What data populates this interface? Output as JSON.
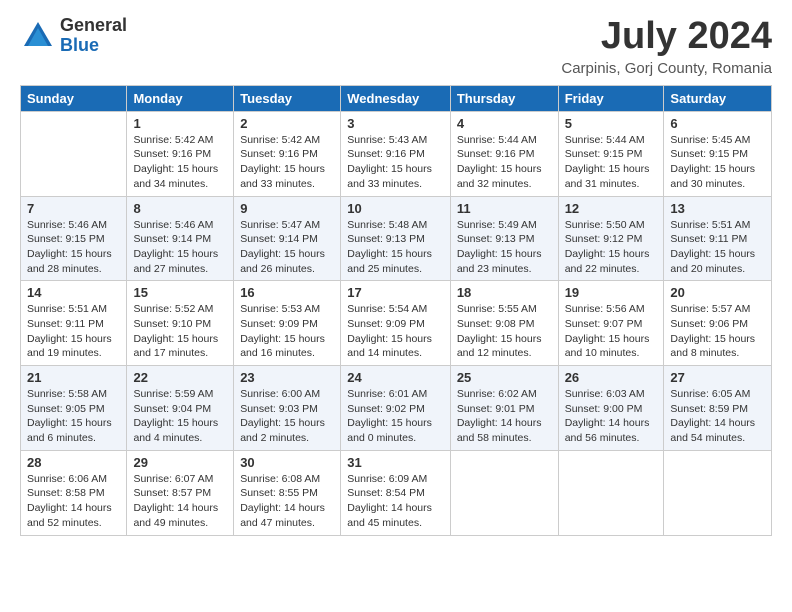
{
  "header": {
    "logo_general": "General",
    "logo_blue": "Blue",
    "title": "July 2024",
    "subtitle": "Carpinis, Gorj County, Romania"
  },
  "weekdays": [
    "Sunday",
    "Monday",
    "Tuesday",
    "Wednesday",
    "Thursday",
    "Friday",
    "Saturday"
  ],
  "weeks": [
    [
      {
        "day": "",
        "info": ""
      },
      {
        "day": "1",
        "info": "Sunrise: 5:42 AM\nSunset: 9:16 PM\nDaylight: 15 hours\nand 34 minutes."
      },
      {
        "day": "2",
        "info": "Sunrise: 5:42 AM\nSunset: 9:16 PM\nDaylight: 15 hours\nand 33 minutes."
      },
      {
        "day": "3",
        "info": "Sunrise: 5:43 AM\nSunset: 9:16 PM\nDaylight: 15 hours\nand 33 minutes."
      },
      {
        "day": "4",
        "info": "Sunrise: 5:44 AM\nSunset: 9:16 PM\nDaylight: 15 hours\nand 32 minutes."
      },
      {
        "day": "5",
        "info": "Sunrise: 5:44 AM\nSunset: 9:15 PM\nDaylight: 15 hours\nand 31 minutes."
      },
      {
        "day": "6",
        "info": "Sunrise: 5:45 AM\nSunset: 9:15 PM\nDaylight: 15 hours\nand 30 minutes."
      }
    ],
    [
      {
        "day": "7",
        "info": "Sunrise: 5:46 AM\nSunset: 9:15 PM\nDaylight: 15 hours\nand 28 minutes."
      },
      {
        "day": "8",
        "info": "Sunrise: 5:46 AM\nSunset: 9:14 PM\nDaylight: 15 hours\nand 27 minutes."
      },
      {
        "day": "9",
        "info": "Sunrise: 5:47 AM\nSunset: 9:14 PM\nDaylight: 15 hours\nand 26 minutes."
      },
      {
        "day": "10",
        "info": "Sunrise: 5:48 AM\nSunset: 9:13 PM\nDaylight: 15 hours\nand 25 minutes."
      },
      {
        "day": "11",
        "info": "Sunrise: 5:49 AM\nSunset: 9:13 PM\nDaylight: 15 hours\nand 23 minutes."
      },
      {
        "day": "12",
        "info": "Sunrise: 5:50 AM\nSunset: 9:12 PM\nDaylight: 15 hours\nand 22 minutes."
      },
      {
        "day": "13",
        "info": "Sunrise: 5:51 AM\nSunset: 9:11 PM\nDaylight: 15 hours\nand 20 minutes."
      }
    ],
    [
      {
        "day": "14",
        "info": "Sunrise: 5:51 AM\nSunset: 9:11 PM\nDaylight: 15 hours\nand 19 minutes."
      },
      {
        "day": "15",
        "info": "Sunrise: 5:52 AM\nSunset: 9:10 PM\nDaylight: 15 hours\nand 17 minutes."
      },
      {
        "day": "16",
        "info": "Sunrise: 5:53 AM\nSunset: 9:09 PM\nDaylight: 15 hours\nand 16 minutes."
      },
      {
        "day": "17",
        "info": "Sunrise: 5:54 AM\nSunset: 9:09 PM\nDaylight: 15 hours\nand 14 minutes."
      },
      {
        "day": "18",
        "info": "Sunrise: 5:55 AM\nSunset: 9:08 PM\nDaylight: 15 hours\nand 12 minutes."
      },
      {
        "day": "19",
        "info": "Sunrise: 5:56 AM\nSunset: 9:07 PM\nDaylight: 15 hours\nand 10 minutes."
      },
      {
        "day": "20",
        "info": "Sunrise: 5:57 AM\nSunset: 9:06 PM\nDaylight: 15 hours\nand 8 minutes."
      }
    ],
    [
      {
        "day": "21",
        "info": "Sunrise: 5:58 AM\nSunset: 9:05 PM\nDaylight: 15 hours\nand 6 minutes."
      },
      {
        "day": "22",
        "info": "Sunrise: 5:59 AM\nSunset: 9:04 PM\nDaylight: 15 hours\nand 4 minutes."
      },
      {
        "day": "23",
        "info": "Sunrise: 6:00 AM\nSunset: 9:03 PM\nDaylight: 15 hours\nand 2 minutes."
      },
      {
        "day": "24",
        "info": "Sunrise: 6:01 AM\nSunset: 9:02 PM\nDaylight: 15 hours\nand 0 minutes."
      },
      {
        "day": "25",
        "info": "Sunrise: 6:02 AM\nSunset: 9:01 PM\nDaylight: 14 hours\nand 58 minutes."
      },
      {
        "day": "26",
        "info": "Sunrise: 6:03 AM\nSunset: 9:00 PM\nDaylight: 14 hours\nand 56 minutes."
      },
      {
        "day": "27",
        "info": "Sunrise: 6:05 AM\nSunset: 8:59 PM\nDaylight: 14 hours\nand 54 minutes."
      }
    ],
    [
      {
        "day": "28",
        "info": "Sunrise: 6:06 AM\nSunset: 8:58 PM\nDaylight: 14 hours\nand 52 minutes."
      },
      {
        "day": "29",
        "info": "Sunrise: 6:07 AM\nSunset: 8:57 PM\nDaylight: 14 hours\nand 49 minutes."
      },
      {
        "day": "30",
        "info": "Sunrise: 6:08 AM\nSunset: 8:55 PM\nDaylight: 14 hours\nand 47 minutes."
      },
      {
        "day": "31",
        "info": "Sunrise: 6:09 AM\nSunset: 8:54 PM\nDaylight: 14 hours\nand 45 minutes."
      },
      {
        "day": "",
        "info": ""
      },
      {
        "day": "",
        "info": ""
      },
      {
        "day": "",
        "info": ""
      }
    ]
  ]
}
